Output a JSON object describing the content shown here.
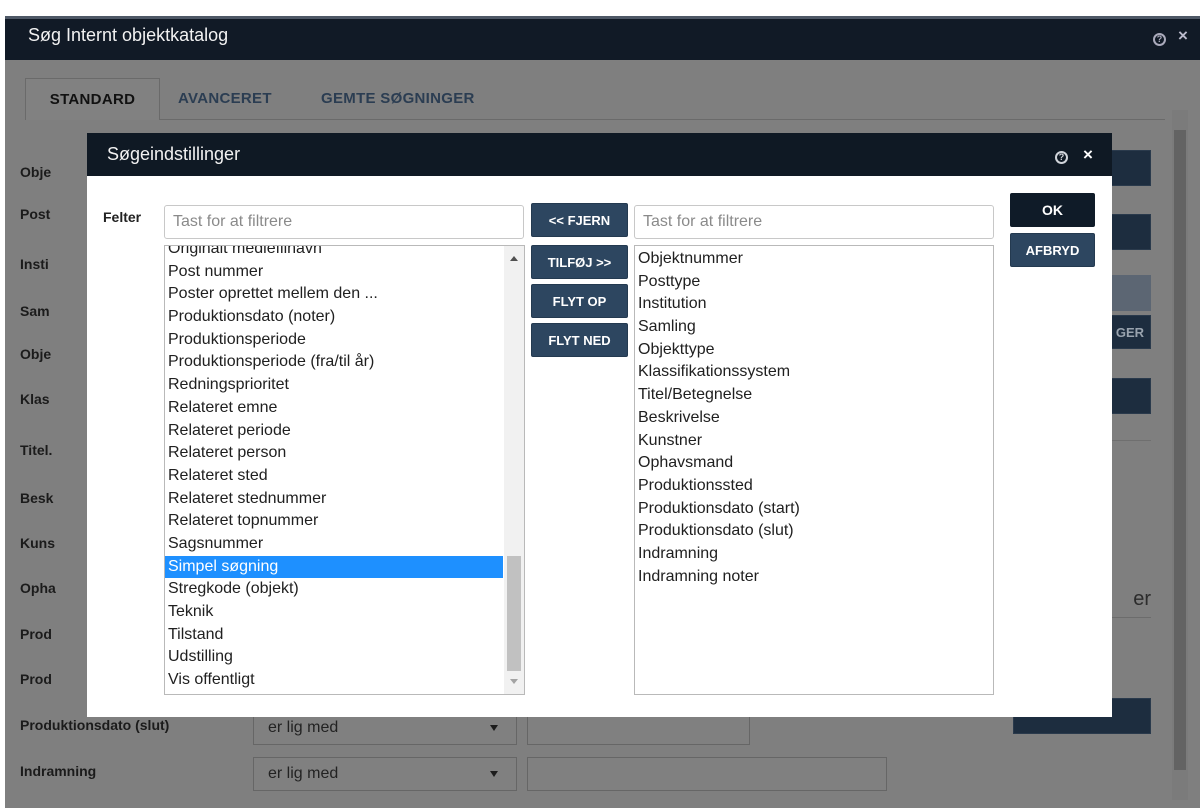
{
  "outer_window": {
    "title": "Søg Internt objektkatalog",
    "help_icon": "help-circle-icon",
    "close_icon": "close-icon",
    "tabs": [
      {
        "label": "STANDARD",
        "active": true
      },
      {
        "label": "AVANCERET",
        "active": false
      },
      {
        "label": "GEMTE SØGNINGER",
        "active": false
      }
    ],
    "field_labels": [
      "Obje",
      "Post",
      "Insti",
      "Sam",
      "Obje",
      "Klas",
      "Titel.",
      "Besk",
      "Kuns",
      "Opha",
      "Prod",
      "Prod",
      "Produktionsdato (slut)",
      "Indramning"
    ],
    "rows": [
      {
        "operator": "er lig med"
      },
      {
        "operator": "er lig med"
      }
    ],
    "right_button_fragment": "GER",
    "right_text_fragment": "er"
  },
  "modal": {
    "title": "Søgeindstillinger",
    "help_icon": "help-circle-icon",
    "close_icon": "close-icon",
    "felter_label": "Felter",
    "filter_left_placeholder": "Tast for at filtrere",
    "filter_right_placeholder": "Tast for at filtrere",
    "buttons": {
      "fjern": "<< FJERN",
      "tilfoj": "TILFØJ >>",
      "flyt_op": "FLYT OP",
      "flyt_ned": "FLYT NED",
      "ok": "OK",
      "afbryd": "AFBRYD"
    },
    "available_fields": [
      "Originalt mediefilnavn",
      "Post nummer",
      "Poster oprettet mellem den ...",
      "Produktionsdato (noter)",
      "Produktionsperiode",
      "Produktionsperiode (fra/til år)",
      "Redningsprioritet",
      "Relateret emne",
      "Relateret periode",
      "Relateret person",
      "Relateret sted",
      "Relateret stednummer",
      "Relateret topnummer",
      "Sagsnummer",
      "Simpel søgning",
      "Stregkode (objekt)",
      "Teknik",
      "Tilstand",
      "Udstilling",
      "Vis offentligt"
    ],
    "available_selected": "Simpel søgning",
    "selected_fields": [
      "Objektnummer",
      "Posttype",
      "Institution",
      "Samling",
      "Objekttype",
      "Klassifikationssystem",
      "Titel/Betegnelse",
      "Beskrivelse",
      "Kunstner",
      "Ophavsmand",
      "Produktionssted",
      "Produktionsdato (start)",
      "Produktionsdato (slut)",
      "Indramning",
      "Indramning noter"
    ]
  }
}
